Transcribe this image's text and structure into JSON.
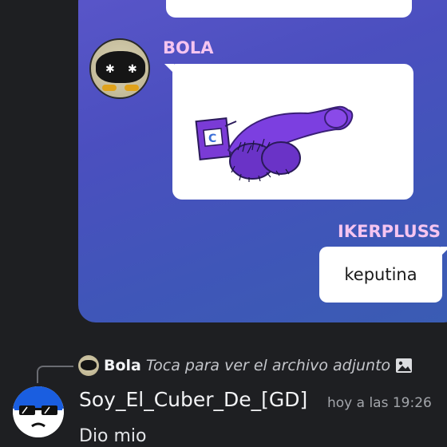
{
  "embed": {
    "sender_name": "BOLA",
    "reply_sender_name": "IKERPLUSS",
    "reply_message": "keputina",
    "accent_name_color": "#f5c4f0",
    "gradient_start": "#5a56c9",
    "gradient_end": "#3a5cb3"
  },
  "reply": {
    "author": "Bola",
    "text": "Toca para ver el archivo adjunto",
    "icon": "image-icon"
  },
  "message": {
    "author": "Soy_El_Cuber_De_[GD]",
    "timestamp": "hoy a las 19:26",
    "text": "Dio mio"
  }
}
